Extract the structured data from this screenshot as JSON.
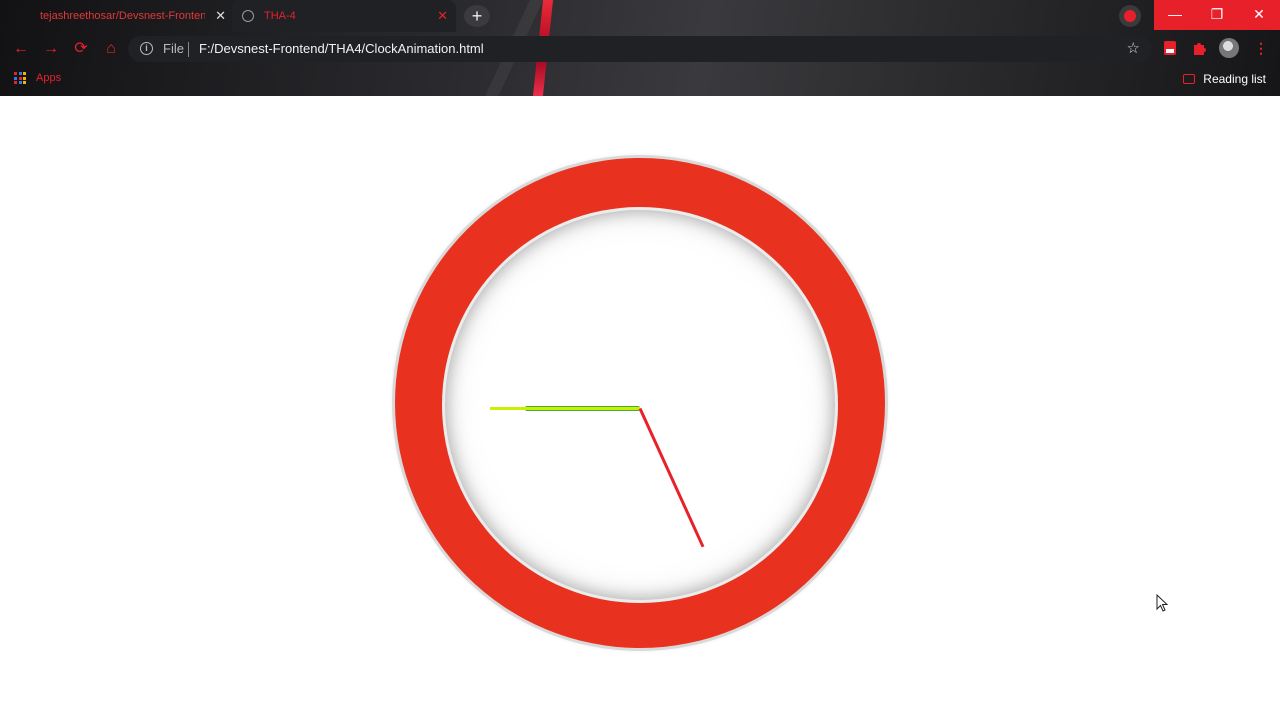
{
  "browser": {
    "tabs": [
      {
        "title": "tejashreethosar/Devsnest-Frontend",
        "close_glyph": "✕"
      },
      {
        "title": "THA-4",
        "close_glyph": "✕",
        "active": true
      }
    ],
    "new_tab_glyph": "+",
    "window_controls": {
      "minimize": "—",
      "maximize": "❐",
      "close": "✕"
    },
    "nav": {
      "back": "←",
      "forward": "→",
      "reload": "⟳",
      "home": "⌂"
    },
    "address": {
      "scheme_label": "File",
      "info_glyph": "i",
      "url": "F:/Devsnest-Frontend/THA4/ClockAnimation.html",
      "star_glyph": "☆"
    },
    "menu_glyph": "⋮",
    "bookmarks": {
      "apps_label": "Apps",
      "reading_list_label": "Reading list"
    },
    "accent_color": "#e8202a"
  },
  "clock": {
    "ring_color": "#e8321f",
    "face_color": "#ffffff",
    "hands": {
      "hour": {
        "color": "#3fae3a",
        "time": "9"
      },
      "minute": {
        "color": "#c8f000",
        "time": "45"
      },
      "second": {
        "color": "#e8202a",
        "time": "24"
      }
    }
  }
}
